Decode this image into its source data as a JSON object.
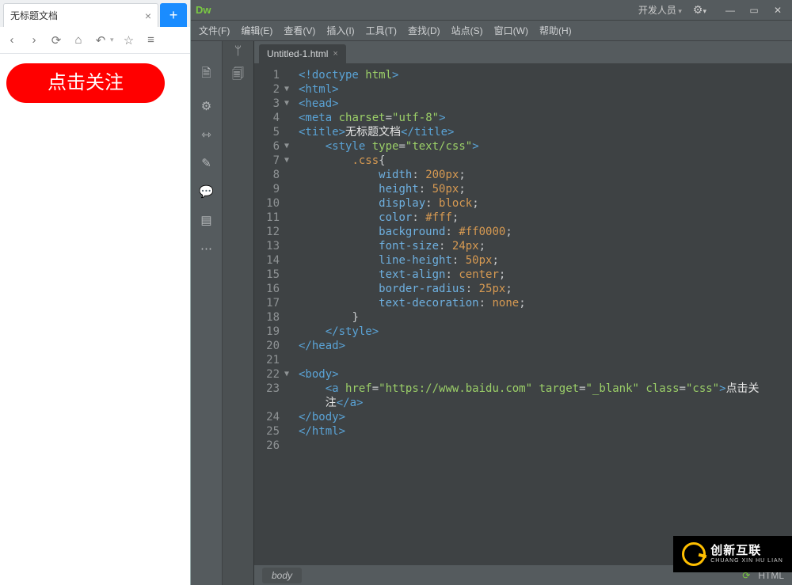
{
  "preview": {
    "tab_title": "无标题文档",
    "button_label": "点击关注"
  },
  "dw": {
    "logo": "Dw",
    "workspace": "开发人员",
    "menus": [
      "文件(F)",
      "编辑(E)",
      "查看(V)",
      "插入(I)",
      "工具(T)",
      "查找(D)",
      "站点(S)",
      "窗口(W)",
      "帮助(H)"
    ],
    "file_tab": "Untitled-1.html",
    "status_selector": "body",
    "status_mode": "HTML"
  },
  "code": {
    "lines": [
      {
        "n": 1,
        "fold": "",
        "html": "<span class='t-tag'>&lt;!doctype</span> <span class='t-attr'>html</span><span class='t-tag'>&gt;</span>"
      },
      {
        "n": 2,
        "fold": "▼",
        "html": "<span class='t-tag'>&lt;html&gt;</span>"
      },
      {
        "n": 3,
        "fold": "▼",
        "html": "<span class='t-tag'>&lt;head&gt;</span>"
      },
      {
        "n": 4,
        "fold": "",
        "html": "<span class='t-tag'>&lt;meta</span> <span class='t-attr'>charset</span><span class='t-punc'>=</span><span class='t-str'>\"utf-8\"</span><span class='t-tag'>&gt;</span>"
      },
      {
        "n": 5,
        "fold": "",
        "html": "<span class='t-tag'>&lt;title&gt;</span><span class='t-text'>无标题文档</span><span class='t-tag'>&lt;/title&gt;</span>"
      },
      {
        "n": 6,
        "fold": "▼",
        "html": "    <span class='t-tag'>&lt;style</span> <span class='t-attr'>type</span><span class='t-punc'>=</span><span class='t-str'>\"text/css\"</span><span class='t-tag'>&gt;</span>"
      },
      {
        "n": 7,
        "fold": "▼",
        "html": "        <span class='t-sel'>.css</span><span class='t-punc'>{</span>"
      },
      {
        "n": 8,
        "fold": "",
        "html": "            <span class='t-prop'>width</span><span class='t-punc'>:</span> <span class='t-val'>200px</span><span class='t-punc'>;</span>"
      },
      {
        "n": 9,
        "fold": "",
        "html": "            <span class='t-prop'>height</span><span class='t-punc'>:</span> <span class='t-val'>50px</span><span class='t-punc'>;</span>"
      },
      {
        "n": 10,
        "fold": "",
        "html": "            <span class='t-prop'>display</span><span class='t-punc'>:</span> <span class='t-val'>block</span><span class='t-punc'>;</span>"
      },
      {
        "n": 11,
        "fold": "",
        "html": "            <span class='t-prop'>color</span><span class='t-punc'>:</span> <span class='t-val'>#fff</span><span class='t-punc'>;</span>"
      },
      {
        "n": 12,
        "fold": "",
        "html": "            <span class='t-prop'>background</span><span class='t-punc'>:</span> <span class='t-val'>#ff0000</span><span class='t-punc'>;</span>"
      },
      {
        "n": 13,
        "fold": "",
        "html": "            <span class='t-prop'>font-size</span><span class='t-punc'>:</span> <span class='t-val'>24px</span><span class='t-punc'>;</span>"
      },
      {
        "n": 14,
        "fold": "",
        "html": "            <span class='t-prop'>line-height</span><span class='t-punc'>:</span> <span class='t-val'>50px</span><span class='t-punc'>;</span>"
      },
      {
        "n": 15,
        "fold": "",
        "html": "            <span class='t-prop'>text-align</span><span class='t-punc'>:</span> <span class='t-val'>center</span><span class='t-punc'>;</span>"
      },
      {
        "n": 16,
        "fold": "",
        "html": "            <span class='t-prop'>border-radius</span><span class='t-punc'>:</span> <span class='t-val'>25px</span><span class='t-punc'>;</span>"
      },
      {
        "n": 17,
        "fold": "",
        "html": "            <span class='t-prop'>text-decoration</span><span class='t-punc'>:</span> <span class='t-val'>none</span><span class='t-punc'>;</span>"
      },
      {
        "n": 18,
        "fold": "",
        "html": "        <span class='t-punc'>}</span>"
      },
      {
        "n": 19,
        "fold": "",
        "html": "    <span class='t-tag'>&lt;/style&gt;</span>"
      },
      {
        "n": 20,
        "fold": "",
        "html": "<span class='t-tag'>&lt;/head&gt;</span>"
      },
      {
        "n": 21,
        "fold": "",
        "html": ""
      },
      {
        "n": 22,
        "fold": "▼",
        "html": "<span class='t-tag'>&lt;body&gt;</span>"
      },
      {
        "n": 23,
        "fold": "",
        "html": "    <span class='t-tag'>&lt;a</span> <span class='t-attr'>href</span><span class='t-punc'>=</span><span class='t-str'>\"https://www.baidu.com\"</span> <span class='t-attr'>target</span><span class='t-punc'>=</span><span class='t-str'>\"_blank\"</span> <span class='t-attr'>class</span><span class='t-punc'>=</span><span class='t-str'>\"css\"</span><span class='t-tag'>&gt;</span><span class='t-text'>点击关</span>"
      },
      {
        "n": "",
        "fold": "",
        "html": "    <span class='t-text'>注</span><span class='t-tag'>&lt;/a&gt;</span>"
      },
      {
        "n": 24,
        "fold": "",
        "html": "<span class='t-tag'>&lt;/body&gt;</span>"
      },
      {
        "n": 25,
        "fold": "",
        "html": "<span class='t-tag'>&lt;/html&gt;</span>"
      },
      {
        "n": 26,
        "fold": "",
        "html": ""
      }
    ]
  },
  "watermark": {
    "big": "创新互联",
    "small": "CHUANG XIN HU LIAN"
  }
}
